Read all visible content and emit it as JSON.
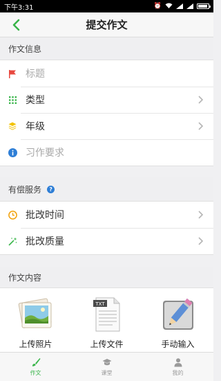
{
  "status_bar": {
    "time": "下午3:31"
  },
  "nav": {
    "title": "提交作文"
  },
  "info_section": {
    "header": "作文信息",
    "rows": [
      {
        "label": "标题",
        "icon": "flag-icon",
        "placeholder": true,
        "chevron": false
      },
      {
        "label": "类型",
        "icon": "grid-dots-icon",
        "placeholder": false,
        "chevron": true
      },
      {
        "label": "年级",
        "icon": "layers-icon",
        "placeholder": false,
        "chevron": true
      },
      {
        "label": "习作要求",
        "icon": "info-icon",
        "placeholder": true,
        "chevron": false
      }
    ]
  },
  "service_section": {
    "header": "有偿服务",
    "help_icon": "?",
    "rows": [
      {
        "label": "批改时间",
        "icon": "clock-icon"
      },
      {
        "label": "批改质量",
        "icon": "magic-wand-icon"
      }
    ]
  },
  "content_section": {
    "header": "作文内容",
    "options": [
      {
        "label": "上传照片",
        "icon": "photo-icon"
      },
      {
        "label": "上传文件",
        "icon": "txt-file-icon",
        "file_tag": "TXT"
      },
      {
        "label": "手动输入",
        "icon": "pencil-icon"
      }
    ]
  },
  "tabs": [
    {
      "label": "作文",
      "icon": "brush-icon",
      "active": true
    },
    {
      "label": "课堂",
      "icon": "graduation-cap-icon",
      "active": false
    },
    {
      "label": "我的",
      "icon": "person-icon",
      "active": false
    }
  ],
  "colors": {
    "accent": "#39b54a",
    "flag": "#e8483f",
    "dots": "#39b54a",
    "layers": "#f2c200",
    "info": "#2e7ed6",
    "clock": "#f2a20c",
    "wand": "#39b54a"
  }
}
